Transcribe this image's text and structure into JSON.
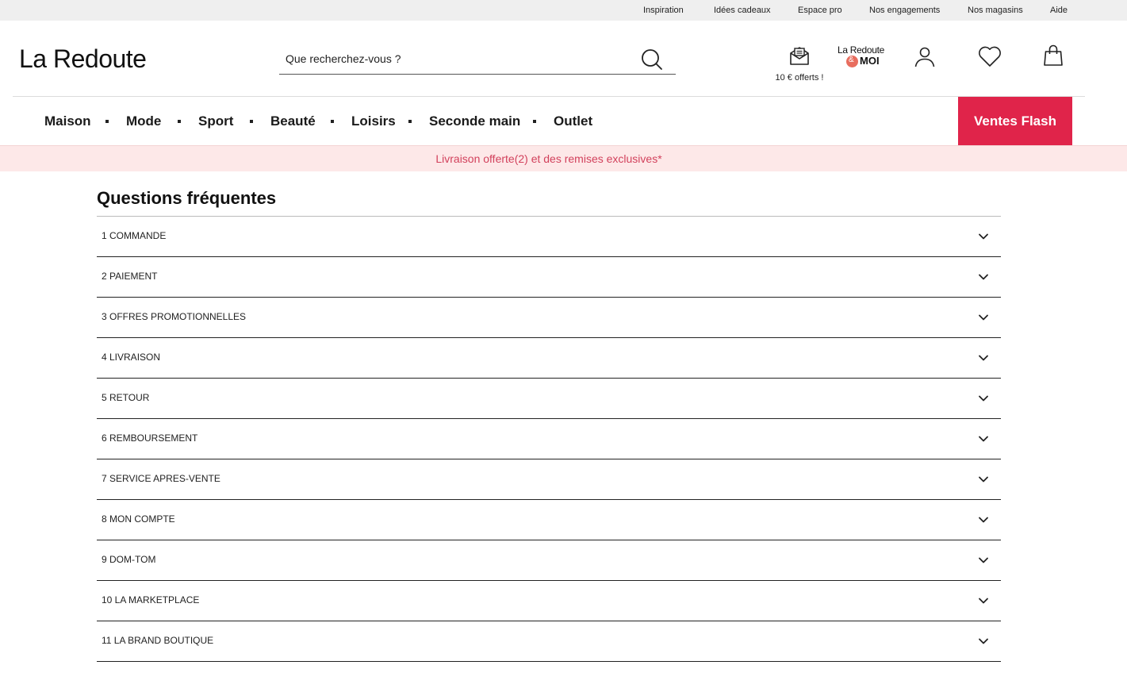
{
  "topbar": {
    "links": [
      "Inspiration",
      "Idées cadeaux",
      "Espace pro",
      "Nos engagements",
      "Nos magasins",
      "Aide"
    ]
  },
  "header": {
    "logo": "La Redoute",
    "search_placeholder": "Que recherchez-vous ?",
    "gift_label": "10 € offerts !",
    "loyalty_line1": "La Redoute",
    "loyalty_amp": "&",
    "loyalty_line2": "MOI",
    "icons": [
      "envelope-gift-icon",
      "user-icon",
      "heart-icon",
      "shopping-bag-icon",
      "search-icon"
    ]
  },
  "nav": {
    "items": [
      "Maison",
      "Mode",
      "Sport",
      "Beauté",
      "Loisirs",
      "Seconde main",
      "Outlet"
    ],
    "flash": "Ventes Flash"
  },
  "promo": {
    "text": "Livraison offerte(2) et des remises exclusives*"
  },
  "faq": {
    "title": "Questions fréquentes",
    "items": [
      "1 COMMANDE",
      "2 PAIEMENT",
      "3 OFFRES PROMOTIONNELLES",
      "4 LIVRAISON",
      "5 RETOUR",
      "6 REMBOURSEMENT",
      "7 SERVICE APRES-VENTE",
      "8 MON COMPTE",
      "9 DOM-TOM",
      "10 LA MARKETPLACE",
      "11 LA BRAND BOUTIQUE"
    ]
  },
  "colors": {
    "accent": "#e0244a",
    "promo_bg": "#fde8e8",
    "promo_text": "#d2415c",
    "topbar_bg": "#efefef",
    "loyalty_amp": "#e86d5e"
  }
}
